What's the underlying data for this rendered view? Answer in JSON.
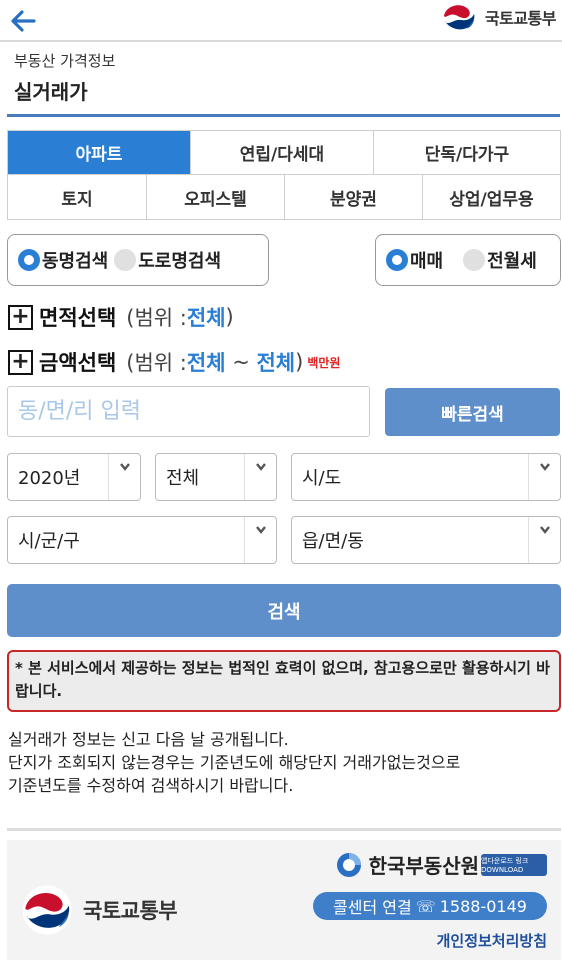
{
  "header": {
    "logo_text": "국토교통부"
  },
  "page": {
    "subtitle": "부동산 가격정보",
    "title": "실거래가"
  },
  "tabs": {
    "row1": [
      "아파트",
      "연립/다세대",
      "단독/다가구"
    ],
    "row2": [
      "토지",
      "오피스텔",
      "분양권",
      "상업/업무용"
    ],
    "active": "아파트"
  },
  "search_type": {
    "option1": "동명검색",
    "option2": "도로명검색"
  },
  "deal_type": {
    "option1": "매매",
    "option2": "전월세"
  },
  "area_select": {
    "label": "면적선택",
    "range_prefix": "(범위 : ",
    "value": "전체",
    "range_suffix": ")"
  },
  "price_select": {
    "label": "금액선택",
    "range_prefix": "(범위 : ",
    "min": "전체",
    "tilde": " ~ ",
    "max": "전체",
    "range_suffix": ")",
    "unit": "백만원"
  },
  "dong_input": {
    "placeholder": "동/면/리 입력",
    "value": ""
  },
  "quick_search_label": "빠른검색",
  "selects": {
    "year": "2020년",
    "month": "전체",
    "sido": "시/도",
    "sigungu": "시/군/구",
    "eupmyeondong": "읍/면/동"
  },
  "search_label": "검색",
  "notice": "* 본 서비스에서 제공하는 정보는 법적인 효력이 없으며, 참고용으로만 활용하시기 바랍니다.",
  "info_lines": [
    "실거래가 정보는 신고 다음 날 공개됩니다.",
    "단지가 조회되지 않는경우는 기준년도에 해당단지 거래가없는것으로",
    "기준년도를 수정하여 검색하시기 바랍니다."
  ],
  "footer": {
    "org_name": "국토교통부",
    "agency_name": "한국부동산원",
    "app_badge": "앱다운로드 링크 DOWNLOAD",
    "call_center_label": "콜센터 연결",
    "call_center_number": "1588-0149",
    "privacy_link": "개인정보처리방침"
  },
  "colors": {
    "accent": "#2a7fd4",
    "button": "#5f8fca",
    "notice_border": "#c62828",
    "title_rule": "#4a7bbd"
  }
}
